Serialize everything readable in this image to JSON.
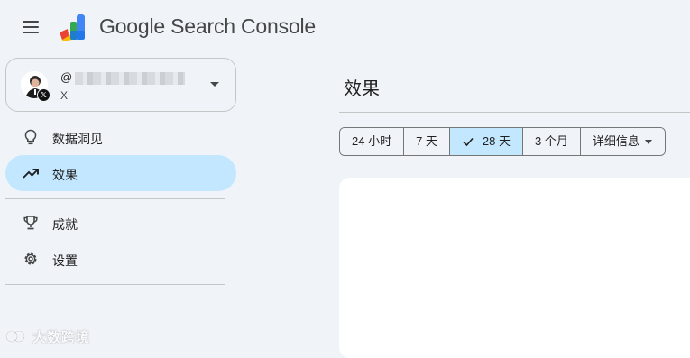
{
  "header": {
    "app_title": "Google Search Console",
    "menu_icon": "hamburger-menu-icon",
    "logo_icon": "search-console-logo"
  },
  "account": {
    "handle_prefix": "@",
    "subtitle": "X",
    "badge_icon": "x-logo-icon",
    "dropdown_icon": "caret-down-icon"
  },
  "sidebar": {
    "items": [
      {
        "label": "数据洞见",
        "icon": "lightbulb-icon",
        "active": false
      },
      {
        "label": "效果",
        "icon": "trending-up-icon",
        "active": true
      },
      {
        "label": "成就",
        "icon": "trophy-icon",
        "active": false
      },
      {
        "label": "设置",
        "icon": "gear-icon",
        "active": false
      }
    ]
  },
  "main": {
    "title": "效果",
    "range_options": [
      "24 小时",
      "7 天",
      "28 天",
      "3 个月",
      "详细信息"
    ],
    "selected_range": "28 天"
  },
  "watermark": {
    "text": "大数跨境"
  },
  "colors": {
    "background": "#f0f4f9",
    "active_fill": "#c2e7ff",
    "border": "#c4c7c5",
    "text": "#1f1f1f"
  }
}
